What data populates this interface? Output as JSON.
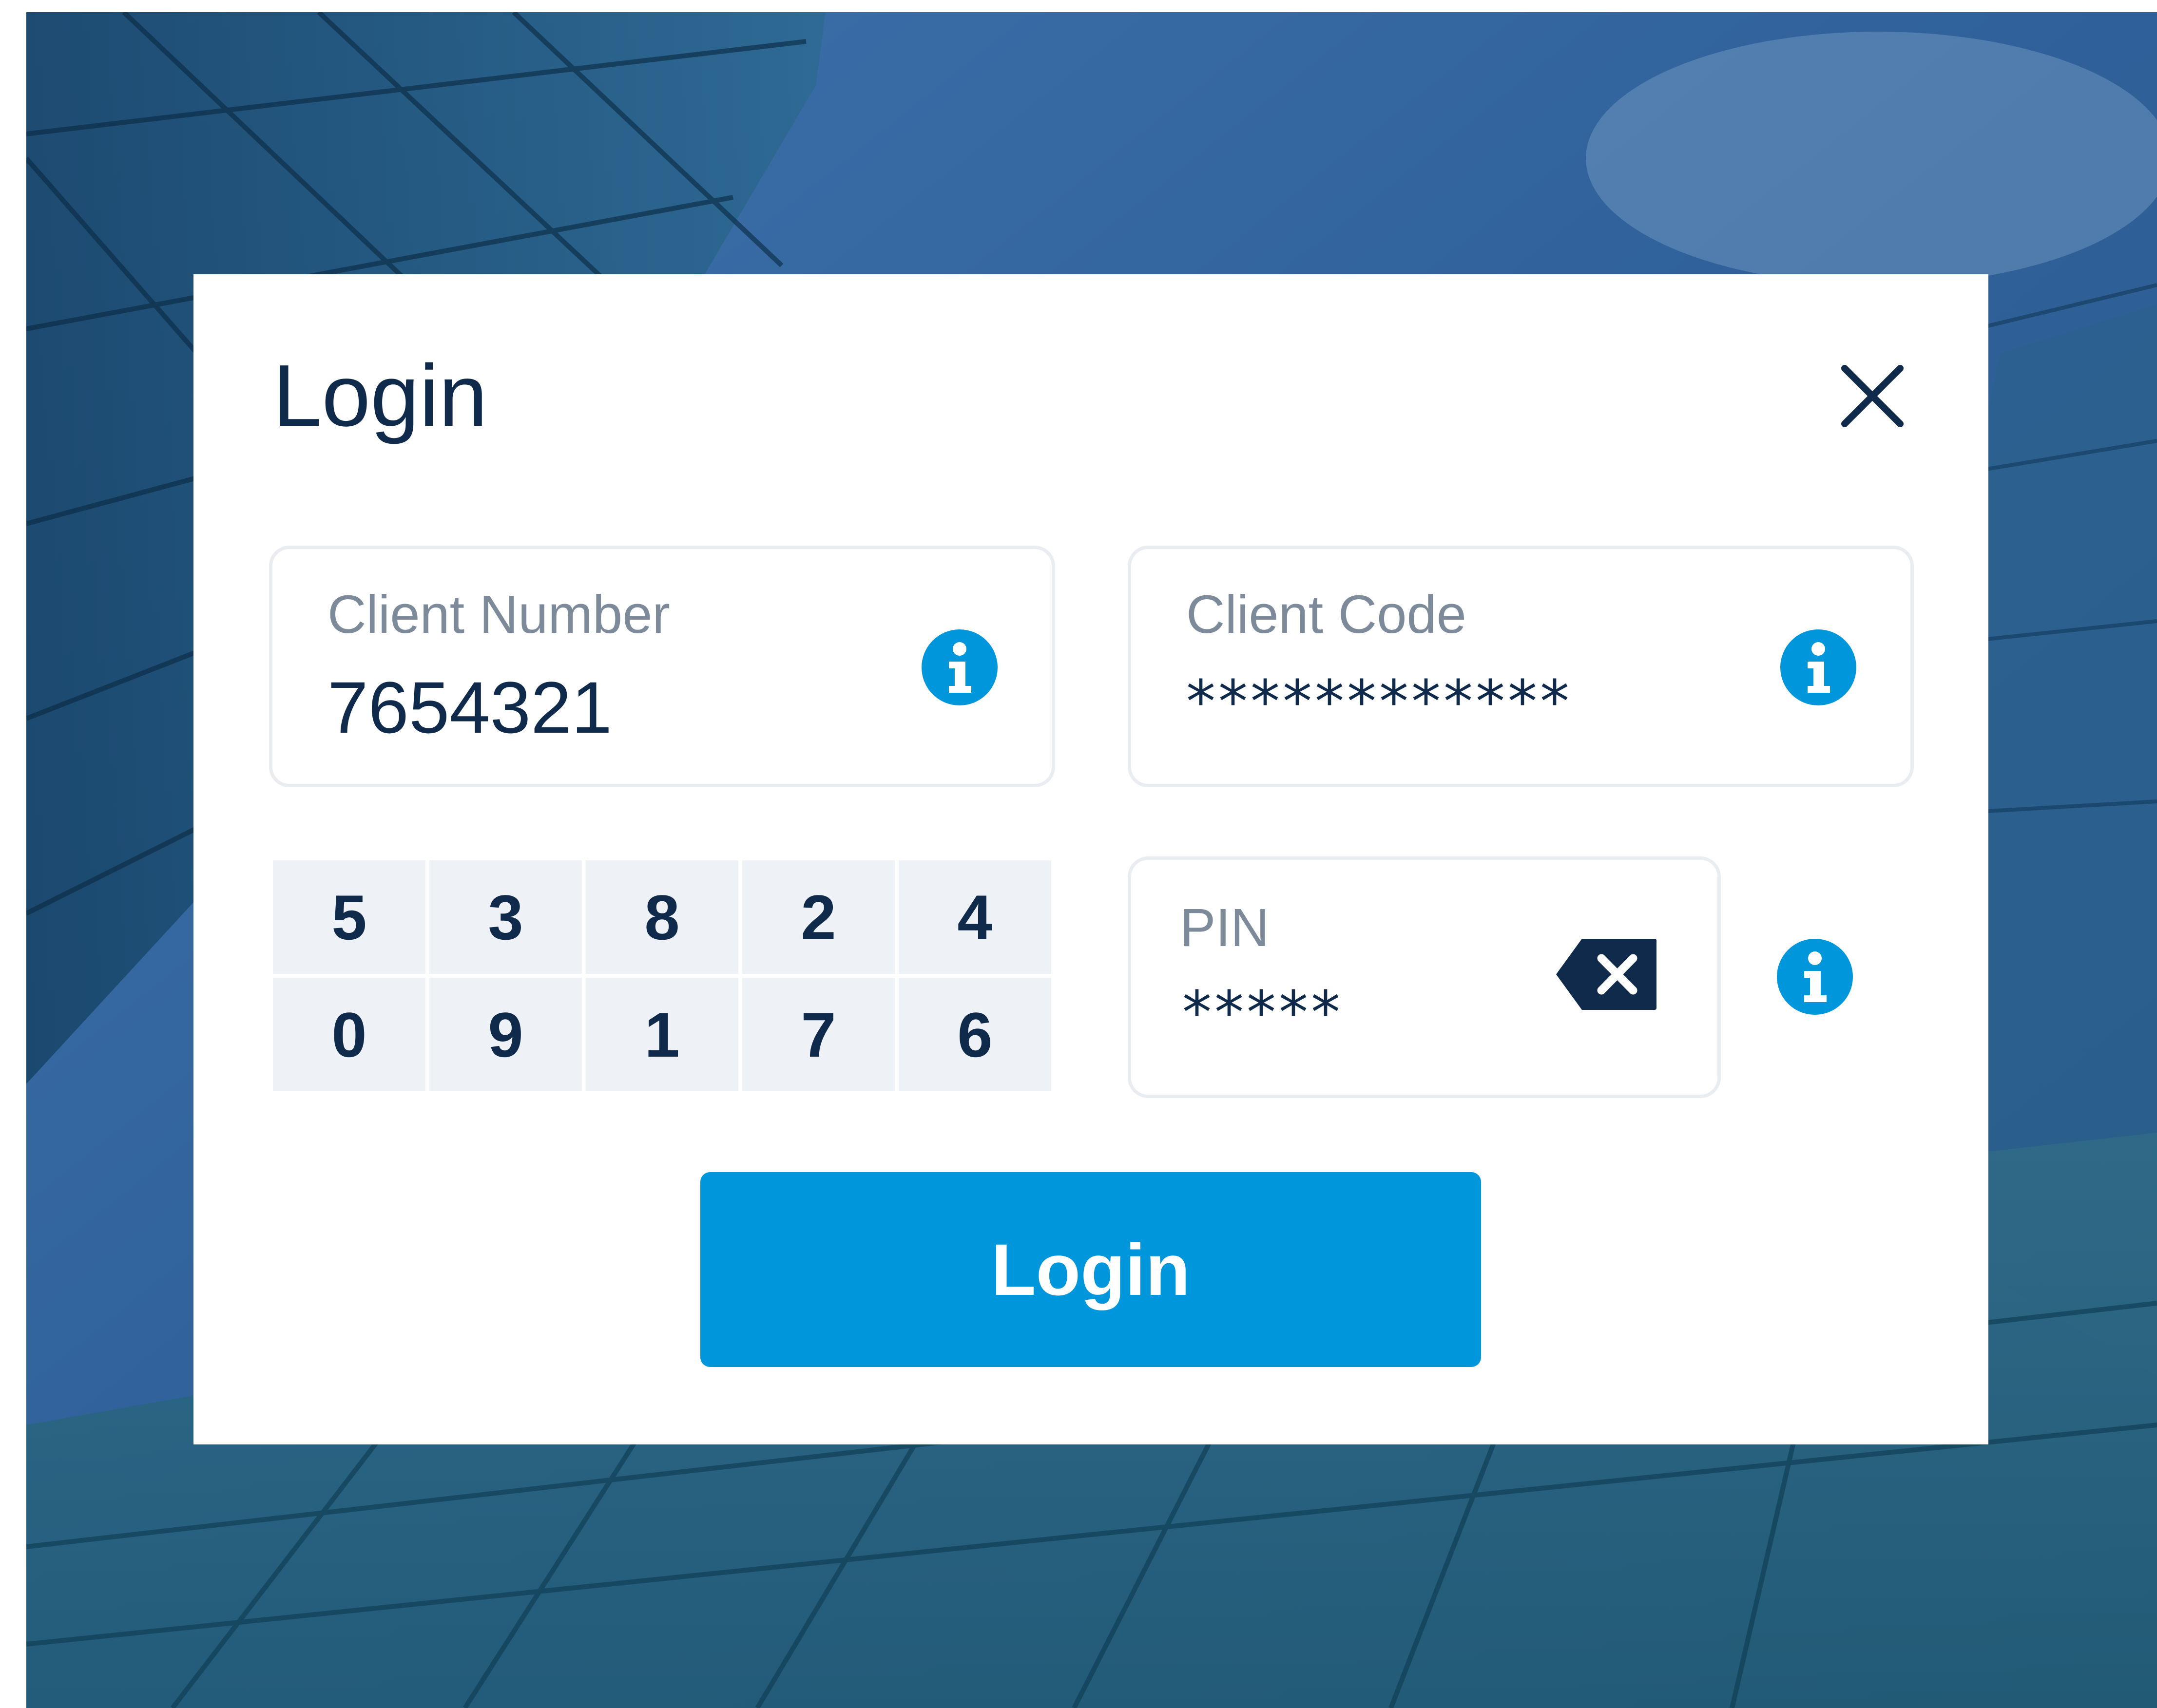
{
  "dialog": {
    "title": "Login",
    "close_icon": "close-icon"
  },
  "client_number": {
    "label": "Client Number",
    "value": "7654321",
    "icon": "info-icon"
  },
  "client_code": {
    "label": "Client Code",
    "value": "************",
    "icon": "info-icon"
  },
  "pin": {
    "label": "PIN",
    "value": "*****",
    "backspace_icon": "backspace-icon",
    "icon": "info-icon"
  },
  "keypad": {
    "keys": [
      "5",
      "3",
      "8",
      "2",
      "4",
      "0",
      "9",
      "1",
      "7",
      "6"
    ]
  },
  "login_button": {
    "label": "Login"
  },
  "colors": {
    "accent": "#0096dc",
    "text_dark": "#0f2a4a",
    "label_gray": "#7d8a99",
    "keypad_bg": "#eef1f5"
  }
}
